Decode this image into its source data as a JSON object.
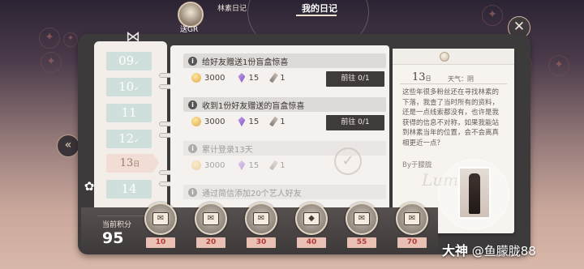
{
  "header": {
    "tab_small": "林素日记",
    "tab_active": "我的日记",
    "avatar_caption": "送GR"
  },
  "calendar": {
    "dates": [
      {
        "label": "09",
        "check": "✓"
      },
      {
        "label": "10",
        "check": "✓"
      },
      {
        "label": "11",
        "check": ""
      },
      {
        "label": "12",
        "check": "✓"
      },
      {
        "label": "13",
        "check": "日",
        "active": true
      },
      {
        "label": "14",
        "check": ""
      }
    ]
  },
  "tasks": [
    {
      "title": "给好友赠送1份盲盒惊喜",
      "coins": "3000",
      "gems": "15",
      "pens": "1",
      "button": "前往 0/1",
      "done": false
    },
    {
      "title": "收到1份好友赠送的盲盒惊喜",
      "coins": "3000",
      "gems": "15",
      "pens": "1",
      "button": "前往 0/1",
      "done": false
    },
    {
      "title": "累计登录13天",
      "coins": "3000",
      "gems": "15",
      "pens": "1",
      "button": "",
      "done": true
    },
    {
      "title": "通过简信添加20个艺人好友",
      "coins": "",
      "gems": "",
      "pens": "",
      "button": "",
      "done": true
    }
  ],
  "diary": {
    "day": "13",
    "day_unit": "日",
    "weather": "天气：阴",
    "text": "这些年很多粉丝还在寻找林素的下落，我查了当时所有的资料，还是一点线索都没有，也许是我获得的信息不对称，如果我能站到林素当年的位置，会不会离真相更近一点？",
    "signature": "By于朦胧",
    "script_watermark": "Lump"
  },
  "score": {
    "label": "当前积分",
    "value": "95"
  },
  "milestones": [
    "10",
    "20",
    "30",
    "40",
    "55",
    "70"
  ],
  "watermark": {
    "brand": "大神",
    "handle": "@鱼朦胧88"
  },
  "colors": {
    "accent_red": "#b23a3a",
    "frame": "#3d3a3b",
    "date_tab": "#cfe0dc"
  }
}
